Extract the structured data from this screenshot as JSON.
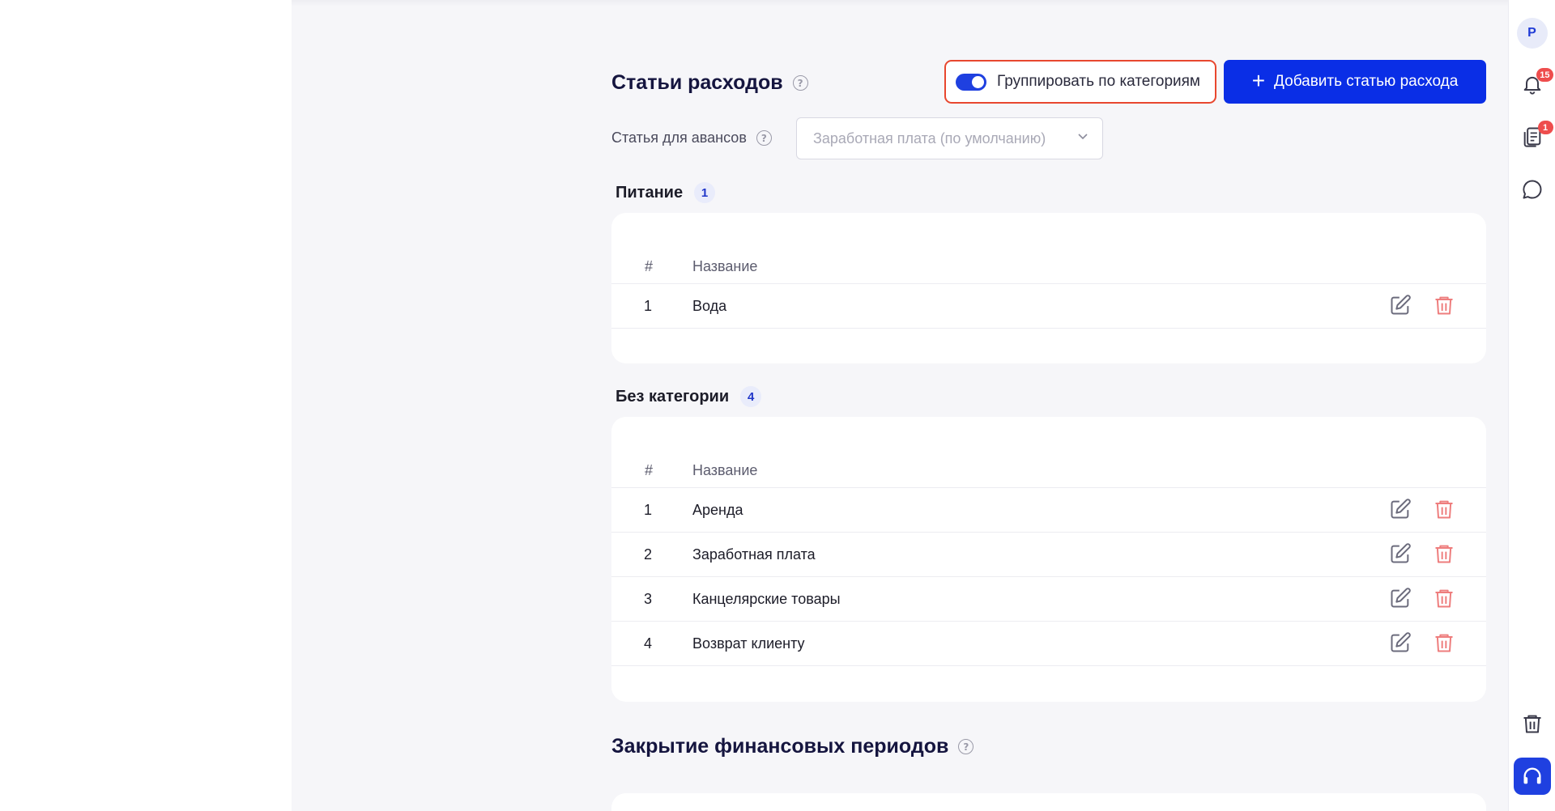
{
  "expenses": {
    "title": "Статьи расходов",
    "group_toggle": {
      "label": "Группировать по категориям",
      "enabled": true
    },
    "add_button_label": "Добавить статью расхода",
    "advance": {
      "label": "Статья для авансов",
      "select_value": "Заработная плата (по умолчанию)"
    },
    "columns": {
      "num": "#",
      "name": "Название"
    },
    "categories": [
      {
        "name": "Питание",
        "count": "1",
        "rows": [
          {
            "num": "1",
            "name": "Вода"
          }
        ]
      },
      {
        "name": "Без категории",
        "count": "4",
        "rows": [
          {
            "num": "1",
            "name": "Аренда"
          },
          {
            "num": "2",
            "name": "Заработная плата"
          },
          {
            "num": "3",
            "name": "Канцелярские товары"
          },
          {
            "num": "4",
            "name": "Возврат клиенту"
          }
        ]
      }
    ]
  },
  "closing": {
    "title": "Закрытие финансовых периодов"
  },
  "rail": {
    "avatar_initial": "P",
    "notifications_count": "15",
    "docs_count": "1"
  },
  "colors": {
    "accent": "#0a2ee6",
    "highlight_border": "#e8472f",
    "delete": "#ee7d7d",
    "badge_red": "#ee4d4d"
  },
  "icons": [
    "help-icon",
    "plus-icon",
    "chevron-down-icon",
    "edit-icon",
    "trash-icon",
    "bell-icon",
    "documents-icon",
    "chat-icon",
    "headset-icon"
  ]
}
